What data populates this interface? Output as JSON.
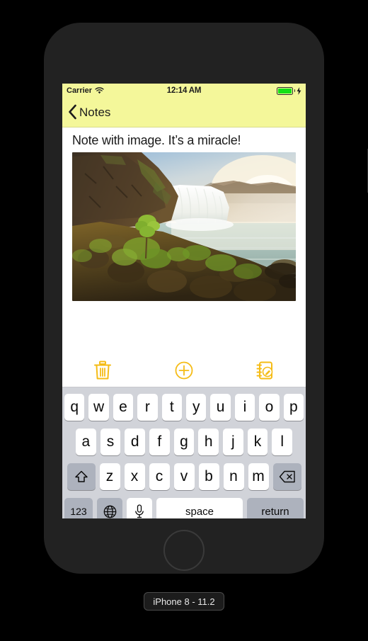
{
  "device": {
    "label": "iPhone 8 - 11.2",
    "home_button": "home-button",
    "buttons": [
      "silent-switch",
      "volume-up",
      "volume-down",
      "power-button"
    ]
  },
  "status_bar": {
    "carrier": "Carrier",
    "wifi_icon": "wifi-icon",
    "time": "12:14 AM",
    "battery_icon": "battery-icon",
    "battery_color": "#14e016",
    "charging_icon": "lightning-bolt-icon",
    "background_color": "#f4f79a"
  },
  "nav_bar": {
    "back_chevron": "‹",
    "back_label": "Notes",
    "background_color": "#f4f79a"
  },
  "note": {
    "title": "Note with image. It’s a miracle!",
    "image_alt": "waterfall-landscape-photo",
    "body_text": ""
  },
  "toolbar": {
    "accent_color": "#f5bc16",
    "items": [
      {
        "name": "delete-note-button",
        "icon": "trash-icon"
      },
      {
        "name": "add-attachment-button",
        "icon": "plus-circle-icon"
      },
      {
        "name": "new-note-button",
        "icon": "compose-note-icon"
      }
    ]
  },
  "keyboard": {
    "row1": [
      "q",
      "w",
      "e",
      "r",
      "t",
      "y",
      "u",
      "i",
      "o",
      "p"
    ],
    "row2": [
      "a",
      "s",
      "d",
      "f",
      "g",
      "h",
      "j",
      "k",
      "l"
    ],
    "row3": [
      "z",
      "x",
      "c",
      "v",
      "b",
      "n",
      "m"
    ],
    "shift_icon": "shift-arrow-icon",
    "backspace_icon": "backspace-delete-icon",
    "numbers_label": "123",
    "globe_icon": "globe-icon",
    "mic_icon": "microphone-icon",
    "space_label": "space",
    "return_label": "return",
    "background_color": "#d1d3d9"
  }
}
